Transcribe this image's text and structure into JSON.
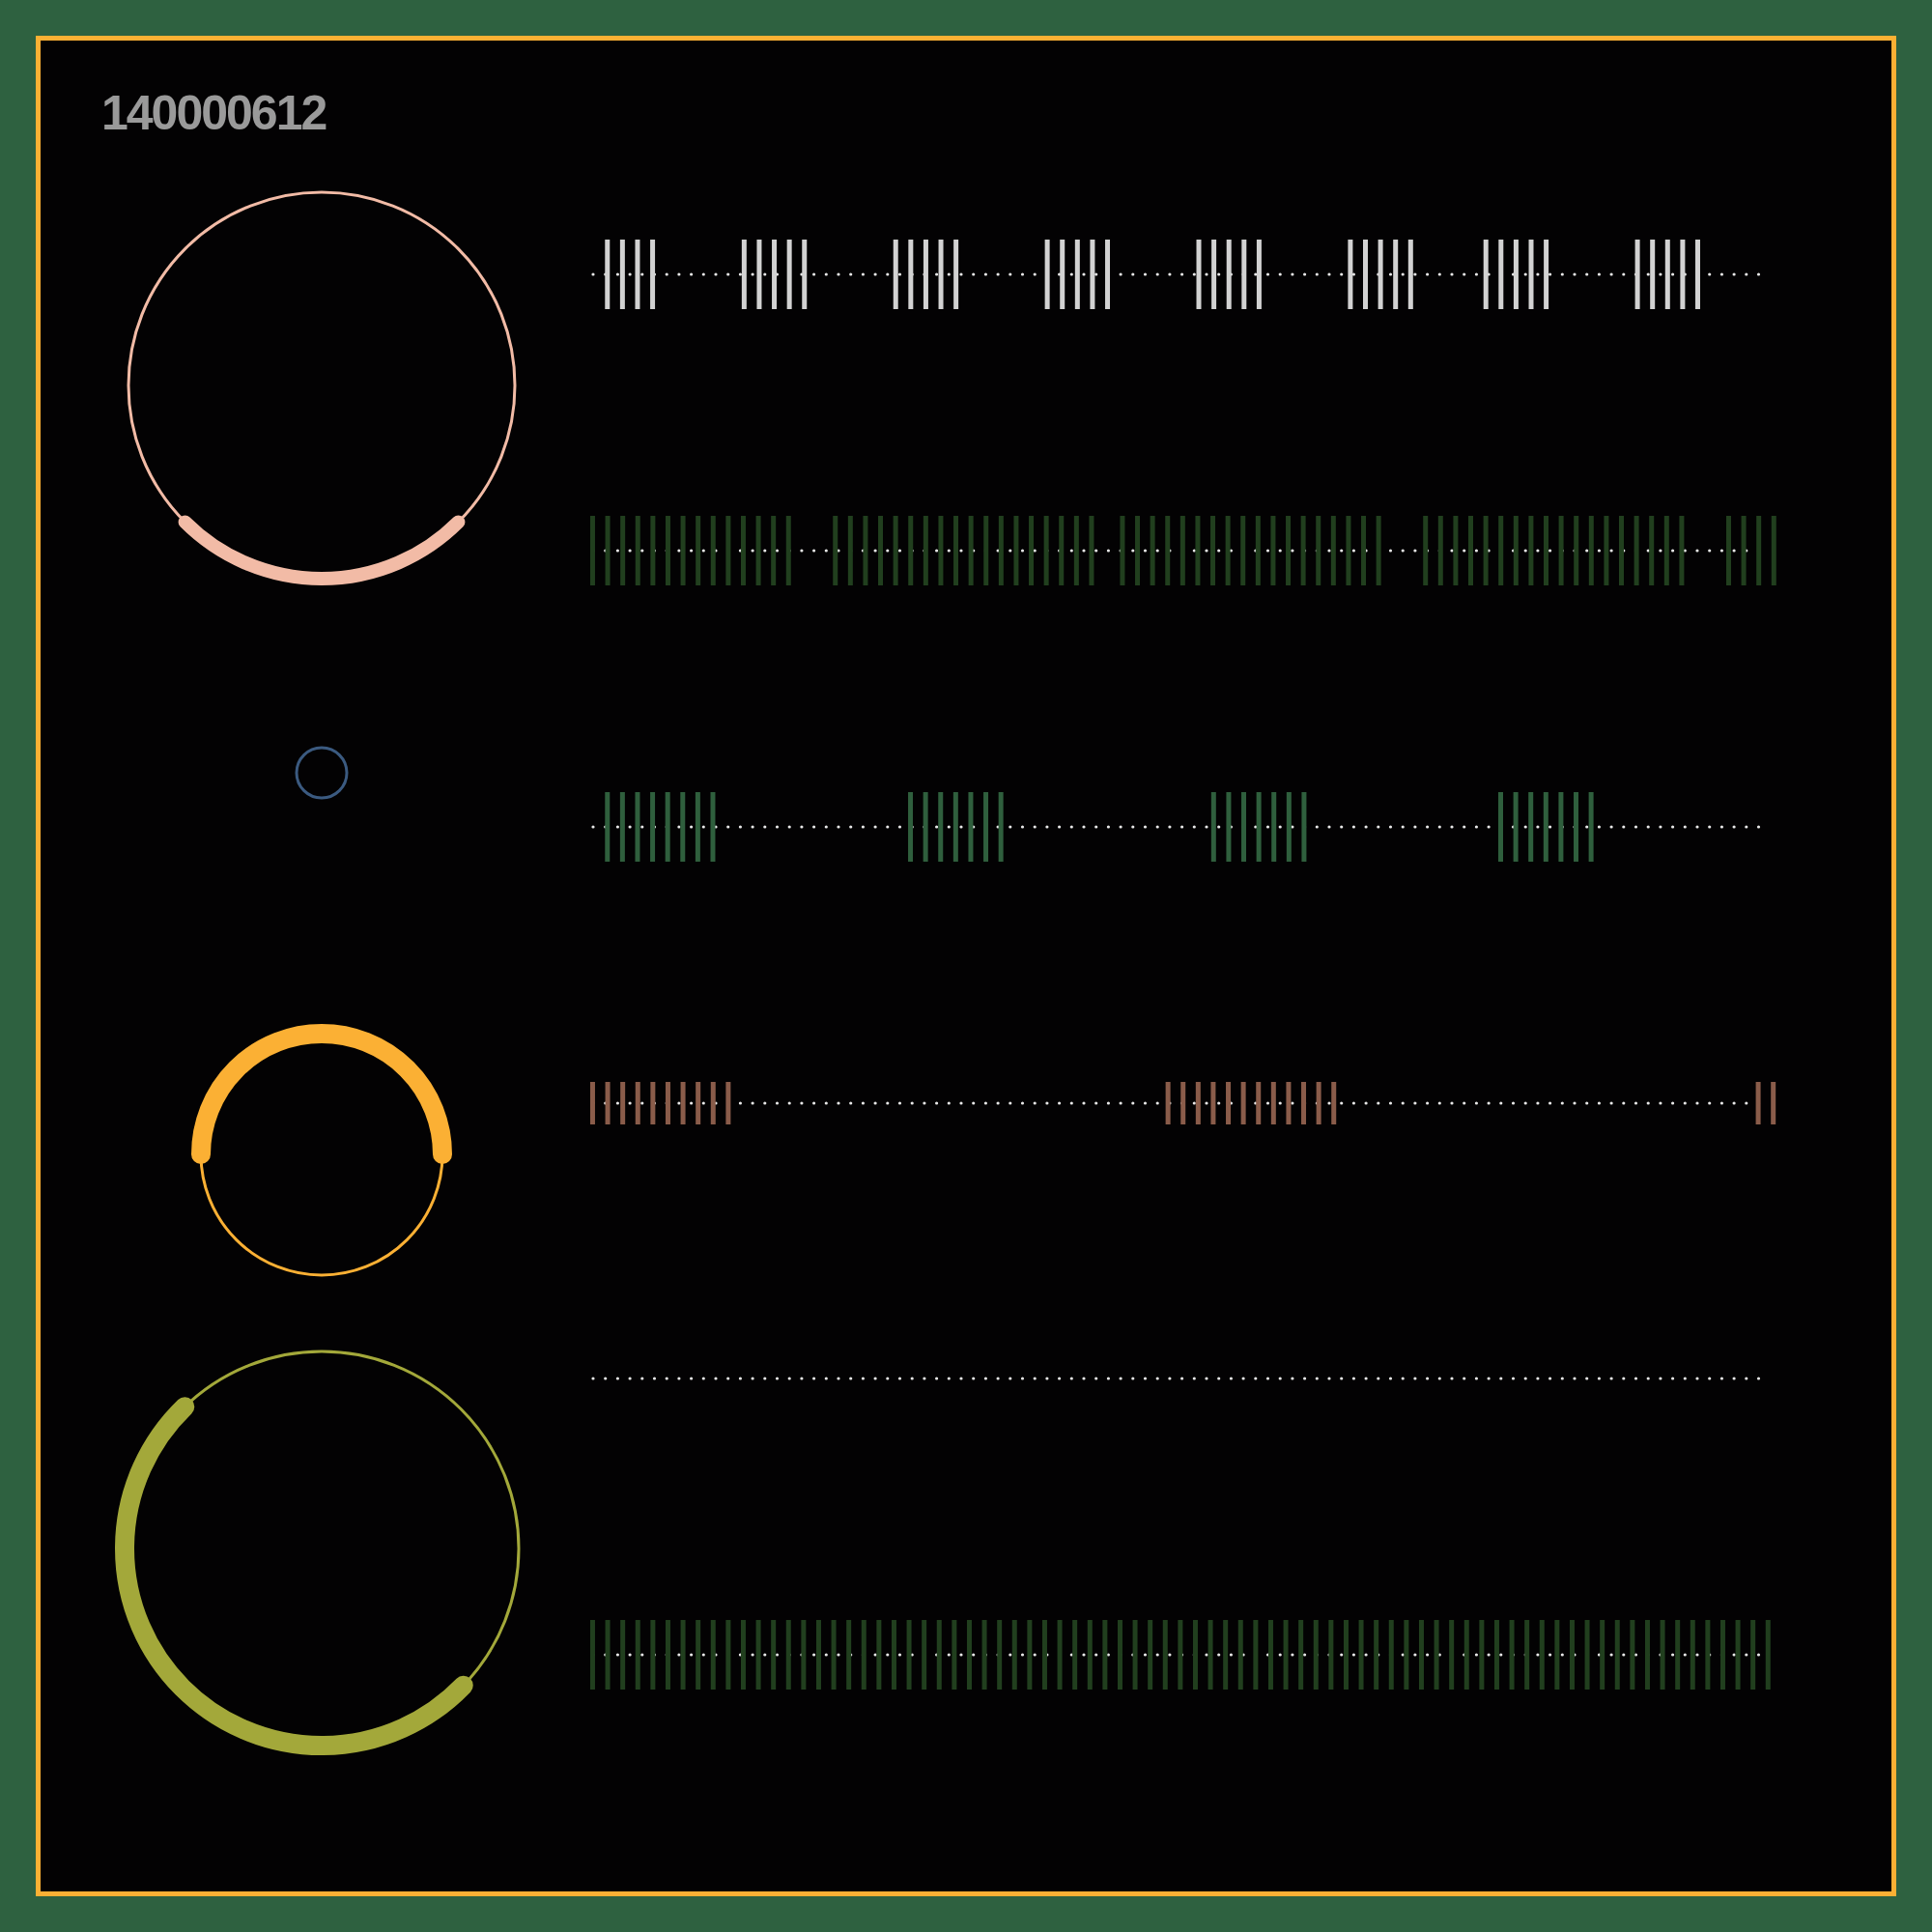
{
  "title": "140000612",
  "rings": [
    {
      "color": "#f2bba6"
    },
    {
      "color": "#3b5a80"
    },
    {
      "color": "#fbb034"
    },
    {
      "color": "#a3a83a"
    }
  ],
  "tracks": [
    {
      "kind": "bars",
      "color": "#d2d2d2"
    },
    {
      "kind": "bars",
      "color": "#213f1e"
    },
    {
      "kind": "bars",
      "color": "#2f5f3d"
    },
    {
      "kind": "bars",
      "color": "#8a5c4a"
    },
    {
      "kind": "dots"
    },
    {
      "kind": "bars",
      "color": "#213f1e"
    }
  ]
}
